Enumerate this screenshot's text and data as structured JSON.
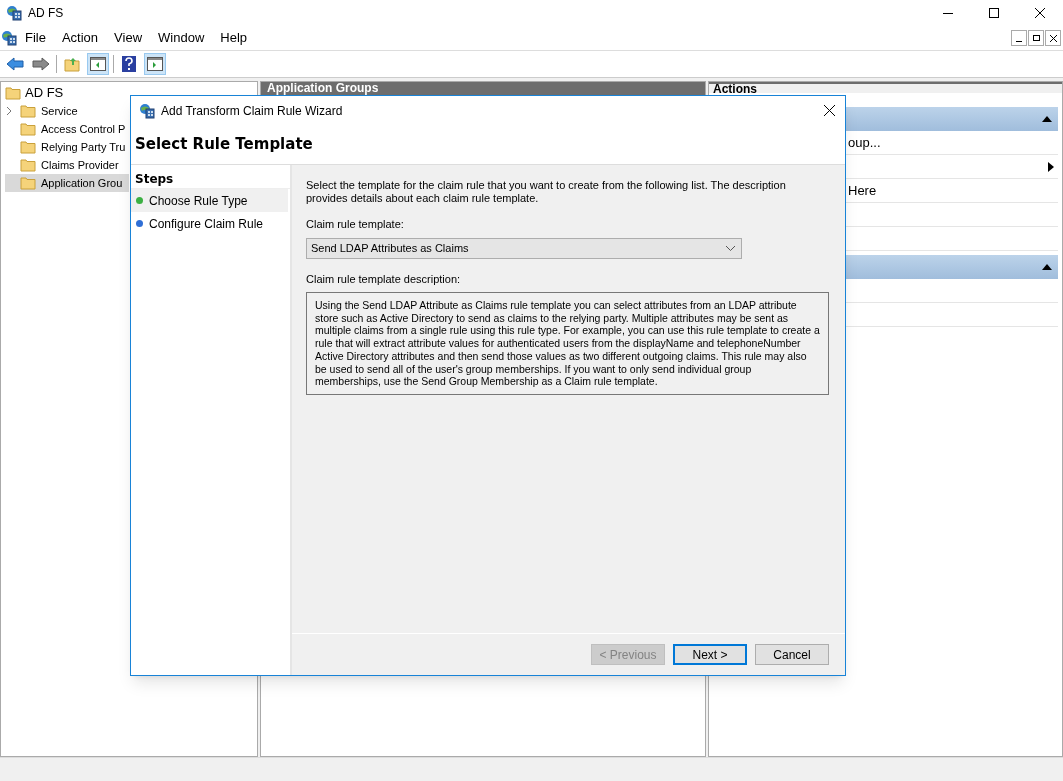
{
  "window": {
    "title": "AD FS"
  },
  "menu": [
    "File",
    "Action",
    "View",
    "Window",
    "Help"
  ],
  "toolbar": [
    {
      "kind": "back"
    },
    {
      "kind": "forward"
    },
    {
      "kind": "up",
      "selected": false
    },
    {
      "kind": "tree",
      "selected": true
    },
    {
      "kind": "help",
      "selected": false
    },
    {
      "kind": "actions",
      "selected": true
    }
  ],
  "tree": {
    "label": "AD FS",
    "children": [
      {
        "label": "Service",
        "expandable": true,
        "selected": false
      },
      {
        "label": "Access Control P",
        "expandable": false,
        "selected": false
      },
      {
        "label": "Relying Party Tru",
        "expandable": false,
        "selected": false
      },
      {
        "label": "Claims Provider",
        "expandable": false,
        "selected": false
      },
      {
        "label": "Application Grou",
        "expandable": false,
        "selected": true
      }
    ]
  },
  "center": {
    "title": "Application Groups"
  },
  "actions": {
    "title": "Actions",
    "rows": [
      {
        "kind": "section"
      },
      {
        "kind": "item",
        "text": "oup..."
      },
      {
        "kind": "submenu"
      },
      {
        "kind": "item",
        "text": "Here"
      },
      {
        "kind": "item",
        "text": ""
      },
      {
        "kind": "item",
        "text": ""
      },
      {
        "kind": "section"
      },
      {
        "kind": "item",
        "text": ""
      },
      {
        "kind": "item",
        "text": ""
      }
    ]
  },
  "dialog": {
    "title": "Add Transform Claim Rule Wizard",
    "heading": "Select Rule Template",
    "steps_title": "Steps",
    "steps": [
      {
        "label": "Choose Rule Type",
        "selected": true,
        "color": "#3cb043"
      },
      {
        "label": "Configure Claim Rule",
        "selected": false,
        "color": "#2f6fd6"
      }
    ],
    "intro": "Select the template for the claim rule that you want to create from the following list. The description provides details about each claim rule template.",
    "template_label": "Claim rule template:",
    "template_value": "Send LDAP Attributes as Claims",
    "description_label": "Claim rule template description:",
    "description": "Using the Send LDAP Attribute as Claims rule template you can select attributes from an LDAP attribute store such as Active Directory to send as claims to the relying party. Multiple attributes may be sent as multiple claims from a single rule using this rule type. For example, you can use this rule template to create a rule that will extract attribute values for authenticated users from the displayName and telephoneNumber Active Directory attributes and then send those values as two different outgoing claims. This rule may also be used to send all of the user's group memberships. If you want to only send individual group memberships, use the Send Group Membership as a Claim rule template.",
    "buttons": [
      {
        "label": "< Previous",
        "disabled": true,
        "default": false
      },
      {
        "label": "Next >",
        "disabled": false,
        "default": true
      },
      {
        "label": "Cancel",
        "disabled": false,
        "default": false
      }
    ]
  }
}
